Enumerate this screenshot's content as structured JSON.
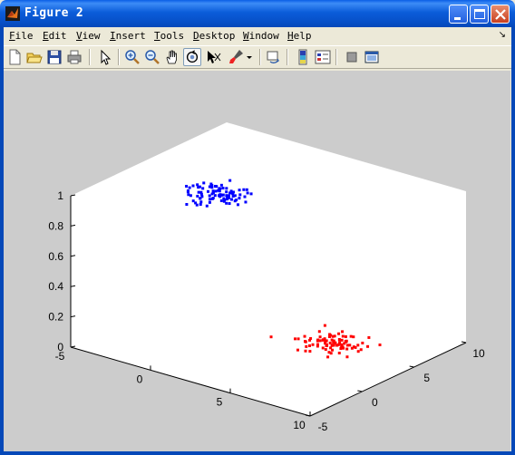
{
  "window": {
    "title": "Figure 2"
  },
  "menu": [
    {
      "key": "F",
      "rest": "ile"
    },
    {
      "key": "E",
      "rest": "dit"
    },
    {
      "key": "V",
      "rest": "iew"
    },
    {
      "key": "I",
      "rest": "nsert"
    },
    {
      "key": "T",
      "rest": "ools"
    },
    {
      "key": "D",
      "rest": "esktop"
    },
    {
      "key": "W",
      "rest": "indow"
    },
    {
      "key": "H",
      "rest": "elp"
    }
  ],
  "toolbar": [
    "new-figure-icon",
    "open-file-icon",
    "save-icon",
    "print-icon",
    "edit-plot-icon",
    "zoom-in-icon",
    "zoom-out-icon",
    "pan-icon",
    "rotate-3d-icon",
    "data-cursor-icon",
    "brush-icon",
    "link-plot-icon",
    "insert-colorbar-icon",
    "insert-legend-icon",
    "hide-plot-tools-icon",
    "show-plot-tools-icon"
  ],
  "chart_data": {
    "type": "scatter3d",
    "xlim": [
      -5,
      10
    ],
    "ylim": [
      -5,
      10
    ],
    "zlim": [
      0,
      1
    ],
    "x_ticks": [
      "-5",
      "0",
      "5",
      "10"
    ],
    "y_ticks": [
      "-5",
      "0",
      "5",
      "10"
    ],
    "z_ticks": [
      "0",
      "0.2",
      "0.4",
      "0.6",
      "0.8",
      "1"
    ],
    "series": [
      {
        "color": "#0000ff",
        "center": [
          0.5,
          0.5,
          1
        ],
        "spread": [
          0.9,
          0.9,
          0
        ],
        "count": 90
      },
      {
        "color": "#ff0000",
        "center": [
          5,
          5,
          0
        ],
        "spread": [
          0.9,
          0.9,
          0
        ],
        "count": 90
      }
    ]
  }
}
